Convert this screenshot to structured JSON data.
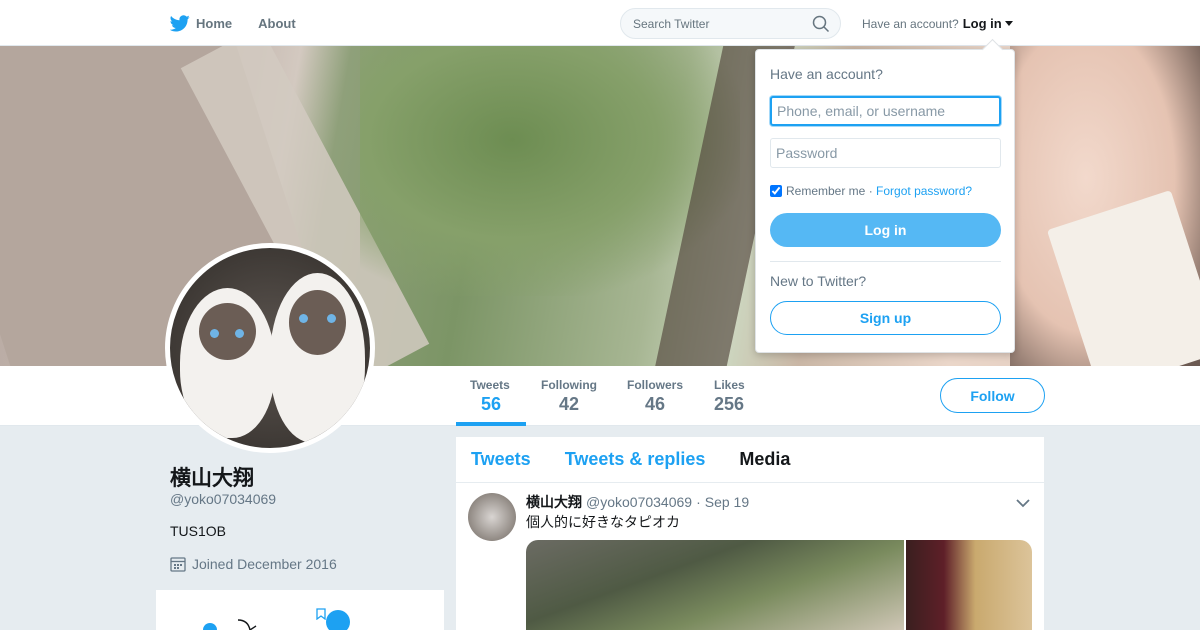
{
  "nav": {
    "home_label": "Home",
    "about_label": "About",
    "search_placeholder": "Search Twitter",
    "account_prompt": "Have an account?",
    "login_label": "Log in"
  },
  "profile": {
    "name": "横山大翔",
    "handle": "@yoko07034069",
    "bio": "TUS1OB",
    "joined": "Joined December 2016",
    "follow_label": "Follow"
  },
  "stats": [
    {
      "label": "Tweets",
      "value": "56",
      "active": true
    },
    {
      "label": "Following",
      "value": "42",
      "active": false
    },
    {
      "label": "Followers",
      "value": "46",
      "active": false
    },
    {
      "label": "Likes",
      "value": "256",
      "active": false
    }
  ],
  "timeline": {
    "tabs": [
      {
        "label": "Tweets",
        "selected": false
      },
      {
        "label": "Tweets & replies",
        "selected": false
      },
      {
        "label": "Media",
        "selected": true
      }
    ],
    "tweet": {
      "name": "横山大翔",
      "handle": "@yoko07034069",
      "separator": "·",
      "date": "Sep 19",
      "text": "個人的に好きなタピオカ"
    }
  },
  "login_dropdown": {
    "title": "Have an account?",
    "username_placeholder": "Phone, email, or username",
    "password_placeholder": "Password",
    "remember_label": "Remember me",
    "separator": "·",
    "forgot_label": "Forgot password?",
    "login_button": "Log in",
    "new_prompt": "New to Twitter?",
    "signup_button": "Sign up"
  },
  "colors": {
    "accent": "#1da1f2",
    "background": "#e6ecf0"
  }
}
